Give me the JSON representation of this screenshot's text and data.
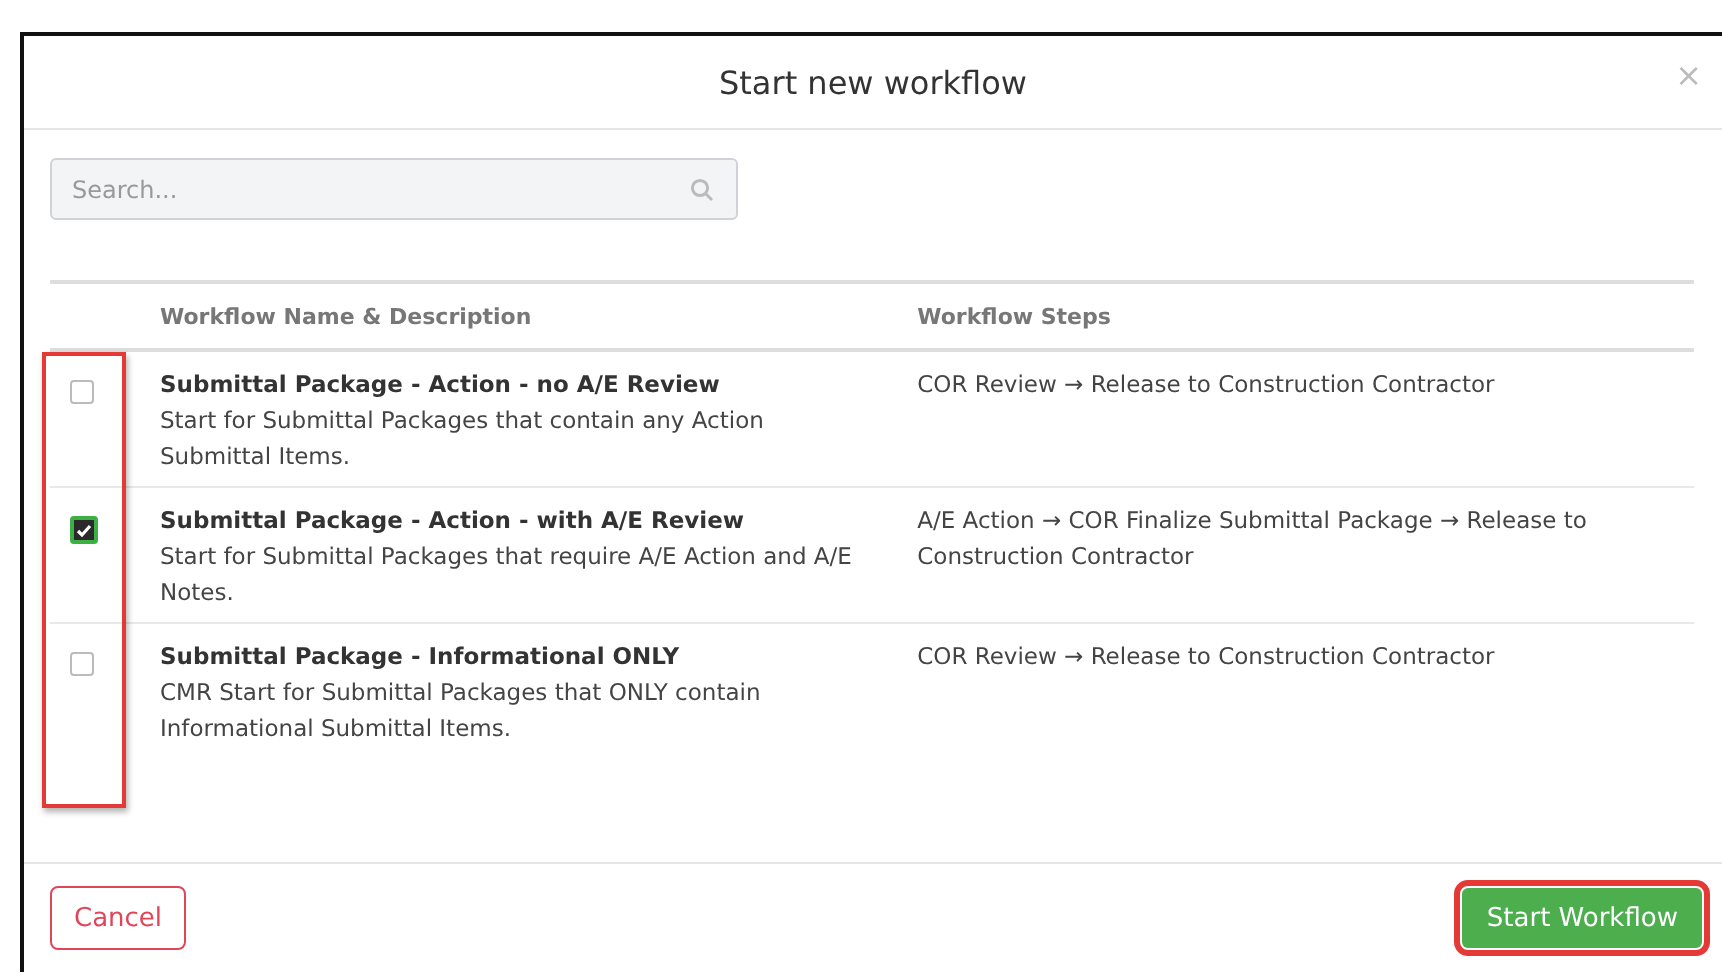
{
  "dialog": {
    "title": "Start new workflow",
    "close": "×"
  },
  "search": {
    "placeholder": "Search..."
  },
  "table": {
    "columns": [
      "Workflow Name & Description",
      "Workflow Steps"
    ],
    "checkboxes_highlighted": true,
    "rows": [
      {
        "name": "Submittal Package - Action - no A/E Review",
        "description": "Start for Submittal Packages that contain any Action Submittal Items.",
        "steps": "COR Review  →  Release to Construction Contractor",
        "checked": false
      },
      {
        "name": "Submittal Package - Action - with A/E Review",
        "description": "Start for Submittal Packages that require A/E Action and A/E Notes.",
        "steps": "A/E Action  →  COR Finalize Submittal Package  →  Release to Construction Contractor",
        "checked": true
      },
      {
        "name": "Submittal Package - Informational ONLY",
        "description": "CMR Start for Submittal Packages that ONLY contain Informational Submittal Items.",
        "steps": "COR Review  →  Release to Construction Contractor",
        "checked": false
      }
    ]
  },
  "footer": {
    "cancel": "Cancel",
    "start": {
      "label": "Start Workflow",
      "highlighted": true
    }
  }
}
